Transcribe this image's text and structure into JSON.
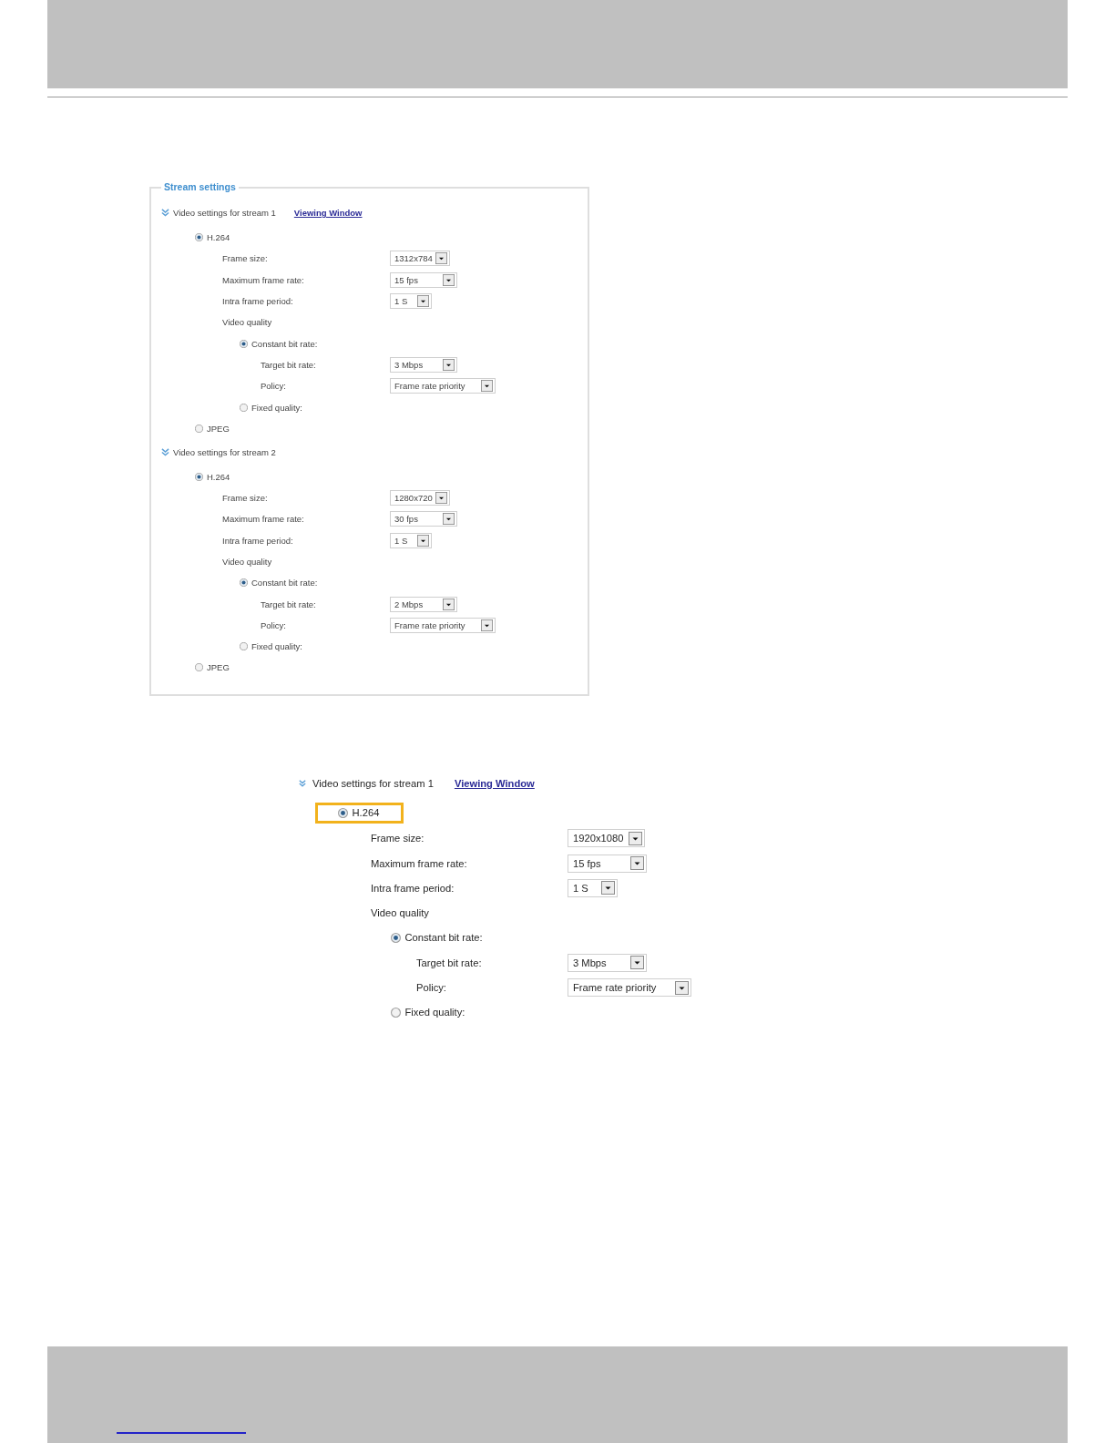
{
  "screenshots": [
    {
      "kind": "panel",
      "legend": "Stream settings",
      "streams": [
        {
          "title": "Video settings for stream 1",
          "expanded": true,
          "link": "Viewing Window",
          "codecs": [
            {
              "label": "H.264",
              "selected": true,
              "fields": [
                {
                  "label": "Frame size:",
                  "value": "1312x784"
                },
                {
                  "label": "Maximum frame rate:",
                  "value": "15 fps"
                },
                {
                  "label": "Intra frame period:",
                  "value": "1 S"
                }
              ],
              "quality": {
                "label": "Video quality",
                "modes": [
                  {
                    "label": "Constant bit rate:",
                    "selected": true,
                    "fields": [
                      {
                        "label": "Target bit rate:",
                        "value": "3 Mbps"
                      },
                      {
                        "label": "Policy:",
                        "value": "Frame rate priority"
                      }
                    ]
                  },
                  {
                    "label": "Fixed quality:",
                    "selected": false
                  }
                ]
              }
            },
            {
              "label": "JPEG",
              "selected": false
            }
          ]
        },
        {
          "title": "Video settings for stream 2",
          "expanded": true,
          "codecs": [
            {
              "label": "H.264",
              "selected": true,
              "fields": [
                {
                  "label": "Frame size:",
                  "value": "1280x720"
                },
                {
                  "label": "Maximum frame rate:",
                  "value": "30 fps"
                },
                {
                  "label": "Intra frame period:",
                  "value": "1 S"
                }
              ],
              "quality": {
                "label": "Video quality",
                "modes": [
                  {
                    "label": "Constant bit rate:",
                    "selected": true,
                    "fields": [
                      {
                        "label": "Target bit rate:",
                        "value": "2 Mbps"
                      },
                      {
                        "label": "Policy:",
                        "value": "Frame rate priority"
                      }
                    ]
                  },
                  {
                    "label": "Fixed quality:",
                    "selected": false
                  }
                ]
              }
            },
            {
              "label": "JPEG",
              "selected": false
            }
          ]
        }
      ]
    },
    {
      "kind": "excerpt",
      "streams": [
        {
          "title": "Video settings for stream 1",
          "expanded": true,
          "link": "Viewing Window",
          "codecs": [
            {
              "label": "H.264",
              "selected": true,
              "highlighted": true,
              "fields": [
                {
                  "label": "Frame size:",
                  "value": "1920x1080"
                },
                {
                  "label": "Maximum frame rate:",
                  "value": "15 fps"
                },
                {
                  "label": "Intra frame period:",
                  "value": "1 S"
                }
              ],
              "quality": {
                "label": "Video quality",
                "modes": [
                  {
                    "label": "Constant bit rate:",
                    "selected": true,
                    "fields": [
                      {
                        "label": "Target bit rate:",
                        "value": "3 Mbps"
                      },
                      {
                        "label": "Policy:",
                        "value": "Frame rate priority"
                      }
                    ]
                  },
                  {
                    "label": "Fixed quality:",
                    "selected": false
                  }
                ]
              }
            }
          ]
        }
      ]
    }
  ]
}
